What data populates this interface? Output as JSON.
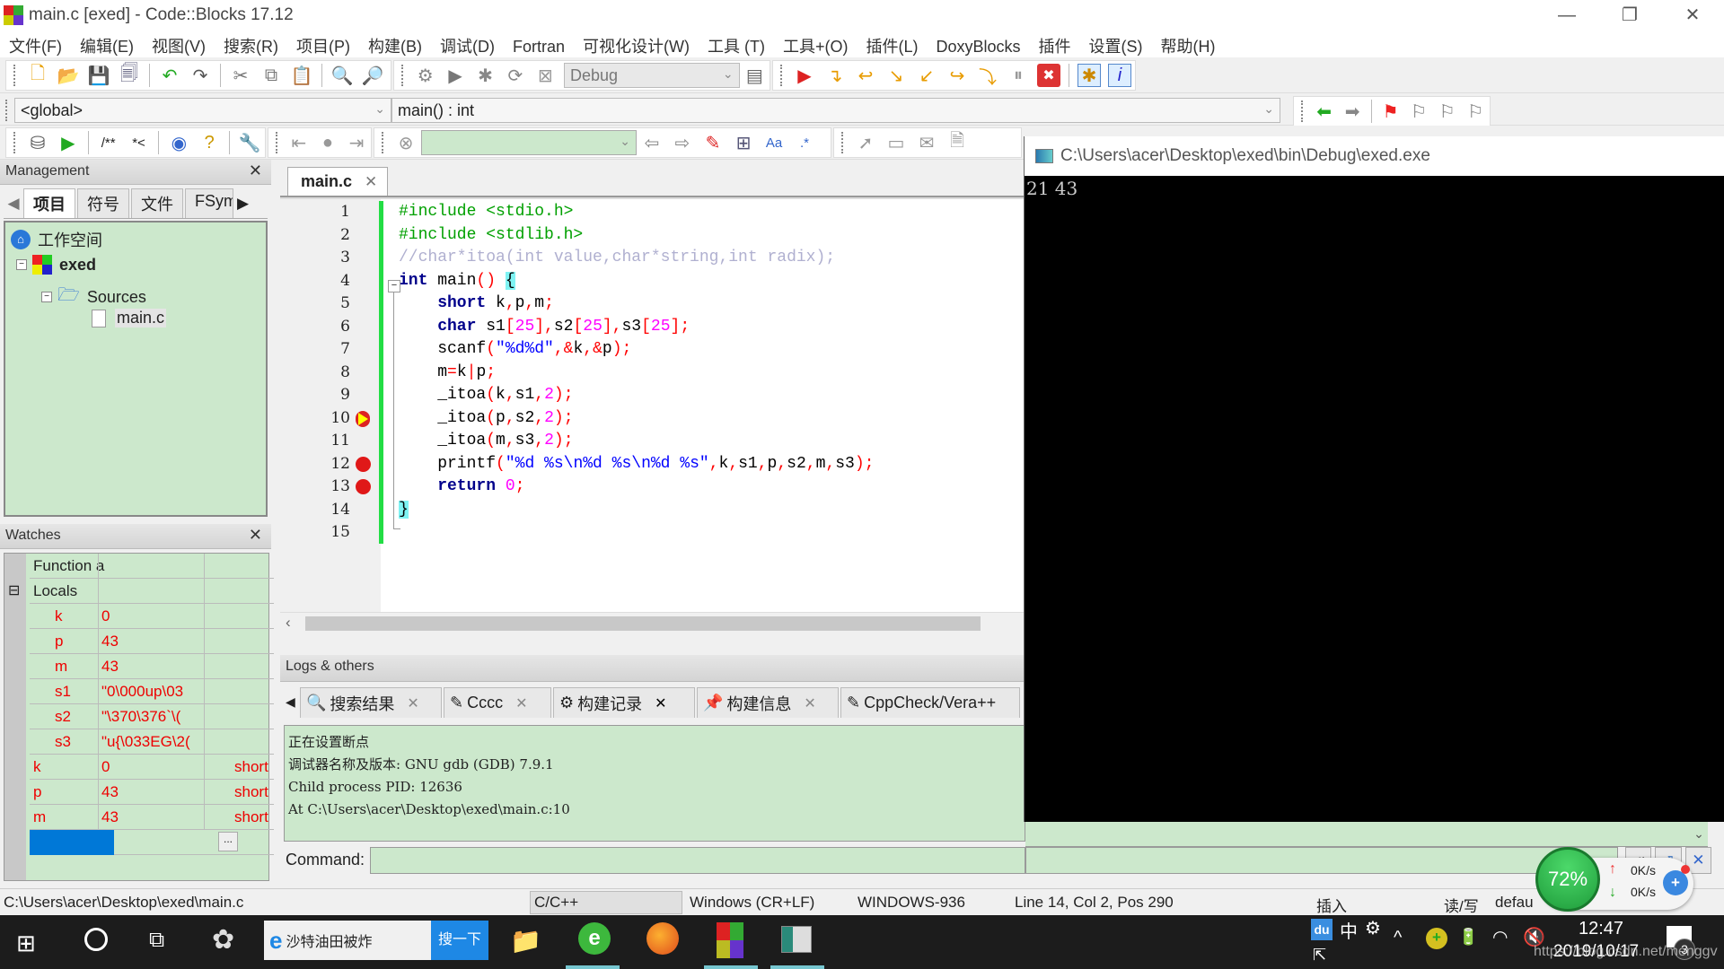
{
  "window": {
    "title": "main.c [exed] - Code::Blocks 17.12",
    "controls": {
      "minimize": "—",
      "restore": "❐",
      "close": "✕"
    }
  },
  "menu": [
    "文件(F)",
    "编辑(E)",
    "视图(V)",
    "搜索(R)",
    "项目(P)",
    "构建(B)",
    "调试(D)",
    "Fortran",
    "可视化设计(W)",
    "工具 (T)",
    "工具+(O)",
    "插件(L)",
    "DoxyBlocks",
    "插件",
    "设置(S)",
    "帮助(H)"
  ],
  "toolbar": {
    "build_target": "Debug",
    "scope": "<global>",
    "function": "main() : int",
    "search_value": ""
  },
  "management": {
    "title": "Management",
    "tabs": [
      "项目",
      "符号",
      "文件",
      "FSym"
    ],
    "active_tab": "项目",
    "tree": {
      "workspace": "工作空间",
      "project": "exed",
      "folder": "Sources",
      "file": "main.c"
    }
  },
  "watches": {
    "title": "Watches",
    "rows": [
      {
        "name": "Function a",
        "value": "",
        "type": "",
        "indent": 0,
        "color": "normal"
      },
      {
        "name": "Locals",
        "value": "",
        "type": "",
        "indent": 0,
        "color": "normal",
        "expander": "⊟"
      },
      {
        "name": "k",
        "value": "0",
        "type": "",
        "indent": 1,
        "color": "red"
      },
      {
        "name": "p",
        "value": "43",
        "type": "",
        "indent": 1,
        "color": "red"
      },
      {
        "name": "m",
        "value": "43",
        "type": "",
        "indent": 1,
        "color": "red"
      },
      {
        "name": "s1",
        "value": "\"0\\000up\\03",
        "type": "",
        "indent": 1,
        "color": "red"
      },
      {
        "name": "s2",
        "value": "\"\\370\\376`\\(",
        "type": "",
        "indent": 1,
        "color": "red"
      },
      {
        "name": "s3",
        "value": "\"u{\\033EG\\2(",
        "type": "",
        "indent": 1,
        "color": "red"
      },
      {
        "name": "k",
        "value": "0",
        "type": "short",
        "indent": 0,
        "color": "red"
      },
      {
        "name": "p",
        "value": "43",
        "type": "short",
        "indent": 0,
        "color": "red"
      },
      {
        "name": "m",
        "value": "43",
        "type": "short",
        "indent": 0,
        "color": "red"
      }
    ],
    "more_button": "..."
  },
  "editor": {
    "tab": "main.c",
    "lines": [
      "1",
      "2",
      "3",
      "4",
      "5",
      "6",
      "7",
      "8",
      "9",
      "10",
      "11",
      "12",
      "13",
      "14",
      "15"
    ],
    "markers": {
      "current_line": 10,
      "breakpoints": [
        12,
        13
      ]
    },
    "code": [
      [
        {
          "t": "#include <stdio.h>",
          "c": "pp"
        }
      ],
      [
        {
          "t": "#include <stdlib.h>",
          "c": "pp"
        }
      ],
      [
        {
          "t": "//char*itoa(int value,char*string,int radix);",
          "c": "cm"
        }
      ],
      [
        {
          "t": "int",
          "c": "kw"
        },
        {
          "t": " main",
          "c": "id"
        },
        {
          "t": "()",
          "c": "op"
        },
        {
          "t": " ",
          "c": "id"
        },
        {
          "t": "{",
          "c": "brace"
        }
      ],
      [
        {
          "t": "    short",
          "c": "kw"
        },
        {
          "t": " k",
          "c": "id"
        },
        {
          "t": ",",
          "c": "op"
        },
        {
          "t": "p",
          "c": "id"
        },
        {
          "t": ",",
          "c": "op"
        },
        {
          "t": "m",
          "c": "id"
        },
        {
          "t": ";",
          "c": "op"
        }
      ],
      [
        {
          "t": "    char",
          "c": "kw"
        },
        {
          "t": " s1",
          "c": "id"
        },
        {
          "t": "[",
          "c": "op"
        },
        {
          "t": "25",
          "c": "num"
        },
        {
          "t": "],",
          "c": "op"
        },
        {
          "t": "s2",
          "c": "id"
        },
        {
          "t": "[",
          "c": "op"
        },
        {
          "t": "25",
          "c": "num"
        },
        {
          "t": "],",
          "c": "op"
        },
        {
          "t": "s3",
          "c": "id"
        },
        {
          "t": "[",
          "c": "op"
        },
        {
          "t": "25",
          "c": "num"
        },
        {
          "t": "];",
          "c": "op"
        }
      ],
      [
        {
          "t": "    scanf",
          "c": "id"
        },
        {
          "t": "(",
          "c": "op"
        },
        {
          "t": "\"%d%d\"",
          "c": "str"
        },
        {
          "t": ",&",
          "c": "op"
        },
        {
          "t": "k",
          "c": "id"
        },
        {
          "t": ",&",
          "c": "op"
        },
        {
          "t": "p",
          "c": "id"
        },
        {
          "t": ");",
          "c": "op"
        }
      ],
      [
        {
          "t": "    m",
          "c": "id"
        },
        {
          "t": "=",
          "c": "op"
        },
        {
          "t": "k",
          "c": "id"
        },
        {
          "t": "|",
          "c": "op"
        },
        {
          "t": "p",
          "c": "id"
        },
        {
          "t": ";",
          "c": "op"
        }
      ],
      [
        {
          "t": "    _itoa",
          "c": "id"
        },
        {
          "t": "(",
          "c": "op"
        },
        {
          "t": "k",
          "c": "id"
        },
        {
          "t": ",",
          "c": "op"
        },
        {
          "t": "s1",
          "c": "id"
        },
        {
          "t": ",",
          "c": "op"
        },
        {
          "t": "2",
          "c": "num"
        },
        {
          "t": ");",
          "c": "op"
        }
      ],
      [
        {
          "t": "    _itoa",
          "c": "id"
        },
        {
          "t": "(",
          "c": "op"
        },
        {
          "t": "p",
          "c": "id"
        },
        {
          "t": ",",
          "c": "op"
        },
        {
          "t": "s2",
          "c": "id"
        },
        {
          "t": ",",
          "c": "op"
        },
        {
          "t": "2",
          "c": "num"
        },
        {
          "t": ");",
          "c": "op"
        }
      ],
      [
        {
          "t": "    _itoa",
          "c": "id"
        },
        {
          "t": "(",
          "c": "op"
        },
        {
          "t": "m",
          "c": "id"
        },
        {
          "t": ",",
          "c": "op"
        },
        {
          "t": "s3",
          "c": "id"
        },
        {
          "t": ",",
          "c": "op"
        },
        {
          "t": "2",
          "c": "num"
        },
        {
          "t": ");",
          "c": "op"
        }
      ],
      [
        {
          "t": "    printf",
          "c": "id"
        },
        {
          "t": "(",
          "c": "op"
        },
        {
          "t": "\"%d %s\\n%d %s\\n%d %s\"",
          "c": "str"
        },
        {
          "t": ",",
          "c": "op"
        },
        {
          "t": "k",
          "c": "id"
        },
        {
          "t": ",",
          "c": "op"
        },
        {
          "t": "s1",
          "c": "id"
        },
        {
          "t": ",",
          "c": "op"
        },
        {
          "t": "p",
          "c": "id"
        },
        {
          "t": ",",
          "c": "op"
        },
        {
          "t": "s2",
          "c": "id"
        },
        {
          "t": ",",
          "c": "op"
        },
        {
          "t": "m",
          "c": "id"
        },
        {
          "t": ",",
          "c": "op"
        },
        {
          "t": "s3",
          "c": "id"
        },
        {
          "t": ");",
          "c": "op"
        }
      ],
      [
        {
          "t": "    return",
          "c": "kw"
        },
        {
          "t": " ",
          "c": "id"
        },
        {
          "t": "0",
          "c": "num"
        },
        {
          "t": ";",
          "c": "op"
        }
      ],
      [
        {
          "t": "}",
          "c": "brace"
        }
      ],
      []
    ]
  },
  "console": {
    "title": "C:\\Users\\acer\\Desktop\\exed\\bin\\Debug\\exed.exe",
    "output": "21 43"
  },
  "logs": {
    "title": "Logs & others",
    "tabs": [
      {
        "label": "搜索结果",
        "icon": "🔍"
      },
      {
        "label": "Cccc",
        "icon": "✎"
      },
      {
        "label": "构建记录",
        "icon": "⚙"
      },
      {
        "label": "构建信息",
        "icon": "📌"
      },
      {
        "label": "CppCheck/Vera++",
        "icon": "✎"
      }
    ],
    "lines": [
      "正在设置断点",
      "调试器名称及版本: GNU gdb (GDB) 7.9.1",
      "Child process PID: 12636",
      "At C:\\Users\\acer\\Desktop\\exed\\main.c:10"
    ],
    "command_label": "Command:",
    "command_value": ""
  },
  "statusbar": {
    "path": "C:\\Users\\acer\\Desktop\\exed\\main.c",
    "language": "C/C++",
    "line_endings": "Windows (CR+LF)",
    "encoding": "WINDOWS-936",
    "position": "Line 14, Col 2, Pos 290",
    "mode": "插入",
    "rw": "读/写",
    "profile": "defau"
  },
  "netwidget": {
    "percent": "72%",
    "up": "0K/s",
    "down": "0K/s"
  },
  "taskbar": {
    "search_text": "沙特油田被炸",
    "search_button": "搜一下",
    "ime": "中",
    "time": "12:47",
    "date": "2019/10/17",
    "notifications": "3",
    "watermark": "https://blog.csdn.net/menggv"
  }
}
